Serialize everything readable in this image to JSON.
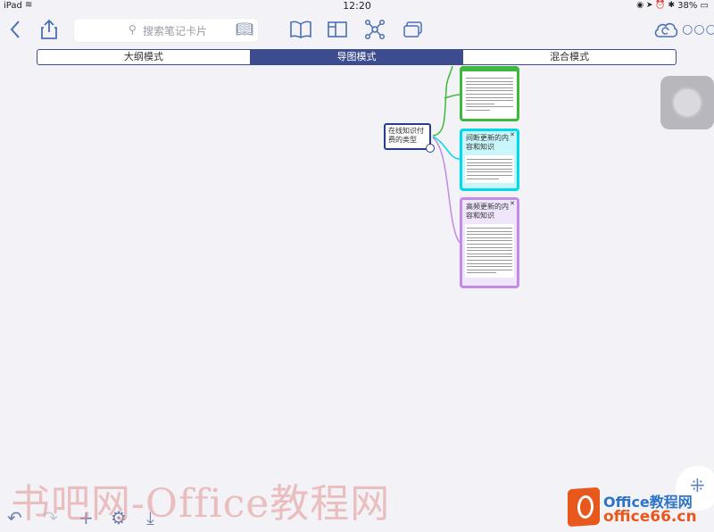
{
  "status_bar": {
    "device": "iPad",
    "wifi_icon": "wifi-icon",
    "time": "12:20",
    "indicators": "◉ ➤ ⏰ ✱",
    "battery": "38%"
  },
  "toolbar": {
    "back_icon": "chevron-left-icon",
    "share_icon": "share-icon",
    "search_placeholder": "搜索笔记卡片",
    "search_icon": "search-icon",
    "book_icon": "book-icon",
    "tabs": [
      {
        "name": "book-view-icon"
      },
      {
        "name": "panel-view-icon"
      },
      {
        "name": "mindmap-view-icon",
        "active": true
      },
      {
        "name": "cards-view-icon"
      }
    ],
    "cloud_icon": "cloud-sync-icon",
    "more_icon": "more-icon"
  },
  "mode_tabs": [
    "大纲模式",
    "导图模式",
    "混合模式"
  ],
  "active_mode": "导图模式",
  "mindmap": {
    "root_label": "在线知识付费的类型",
    "nodes": [
      {
        "title": "",
        "color": "#3eb83e"
      },
      {
        "title": "间断更新的内容和知识",
        "color": "#00d8ec"
      },
      {
        "title": "高频更新的内容和知识",
        "color": "#c18be6"
      }
    ]
  },
  "bottom_toolbar": [
    "undo-icon",
    "redo-icon",
    "add-icon",
    "settings-icon",
    "import-icon"
  ],
  "watermark": {
    "text": "书吧网-Office教程网",
    "logo_line1": "Office教程网",
    "logo_line2": "office66.cn"
  },
  "colors": {
    "accent": "#4a6fb4",
    "segment": "#3d4c8f"
  }
}
